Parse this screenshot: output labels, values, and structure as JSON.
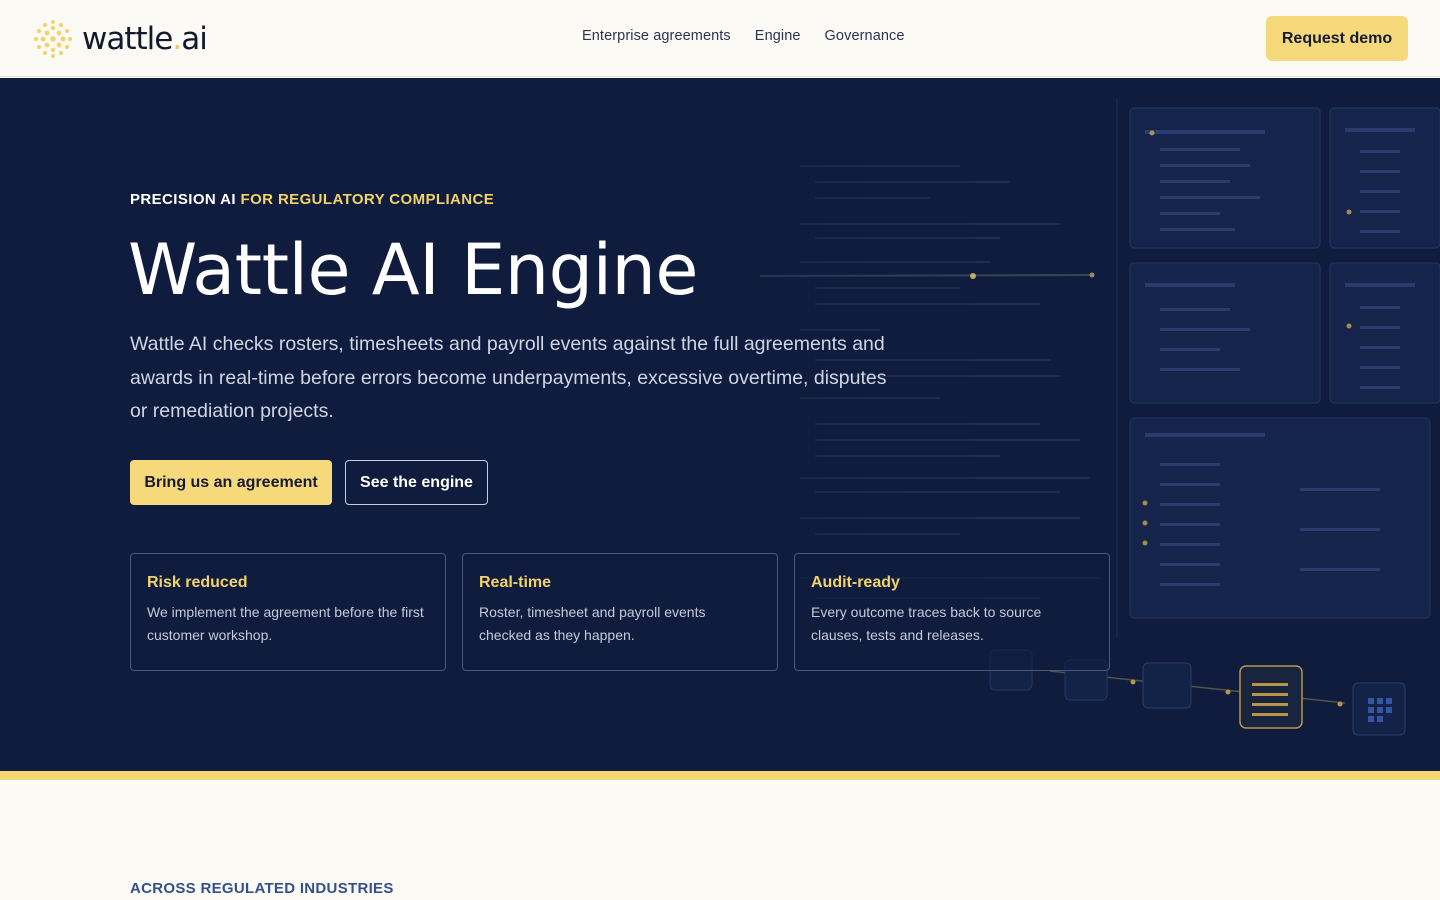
{
  "brand": {
    "name": "wattle",
    "suffix": "ai",
    "accent": "#f2d36a",
    "navy": "#0f1c3d"
  },
  "nav": {
    "items": [
      "Enterprise agreements",
      "Engine",
      "Governance"
    ],
    "cta": "Request demo"
  },
  "hero": {
    "eyebrow_prefix": "PRECISION AI",
    "eyebrow_highlight": "FOR REGULATORY COMPLIANCE",
    "title": "Wattle AI Engine",
    "lead": "Wattle AI checks rosters, timesheets and payroll events against the full agreements and awards in real-time before errors become underpayments, excessive overtime, disputes or remediation projects.",
    "primary_cta": "Bring us an agreement",
    "secondary_cta": "See the engine"
  },
  "cards": [
    {
      "title": "Risk reduced",
      "text": "We implement the agreement before the first customer workshop."
    },
    {
      "title": "Real-time",
      "text": "Roster, timesheet and payroll events checked as they happen."
    },
    {
      "title": "Audit-ready",
      "text": "Every outcome traces back to source clauses, tests and releases."
    }
  ],
  "next_section": {
    "label": "ACROSS REGULATED INDUSTRIES"
  }
}
